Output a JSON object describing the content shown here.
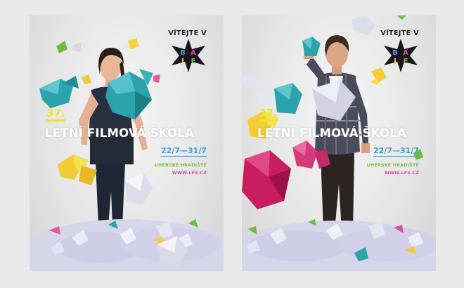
{
  "posters": [
    {
      "welcome": "VÍTEJTE V",
      "edition": "37.",
      "festival": "LETNÍ FILMOVÁ ŠKOLA",
      "dates": "22/7—31/7",
      "city": "UHERSKÉ HRADIŠTĚ",
      "web": "WWW.LFS.CZ"
    },
    {
      "welcome": "VÍTEJTE V",
      "edition": "37.",
      "festival": "LETNÍ FILMOVÁ ŠKOLA",
      "dates": "22/7—31/7",
      "city": "UHERSKÉ HRADIŠTĚ",
      "web": "WWW.LFS.CZ"
    }
  ],
  "logo_letters": [
    "B",
    "A",
    "J",
    "E"
  ],
  "colors": {
    "yellow": "#f1e22a",
    "blue": "#3a9fd6",
    "green": "#7ac143",
    "pink": "#e24a9a",
    "teal": "#2aa3ad",
    "magenta": "#c81e60",
    "logo_bg": "#1a1520"
  }
}
